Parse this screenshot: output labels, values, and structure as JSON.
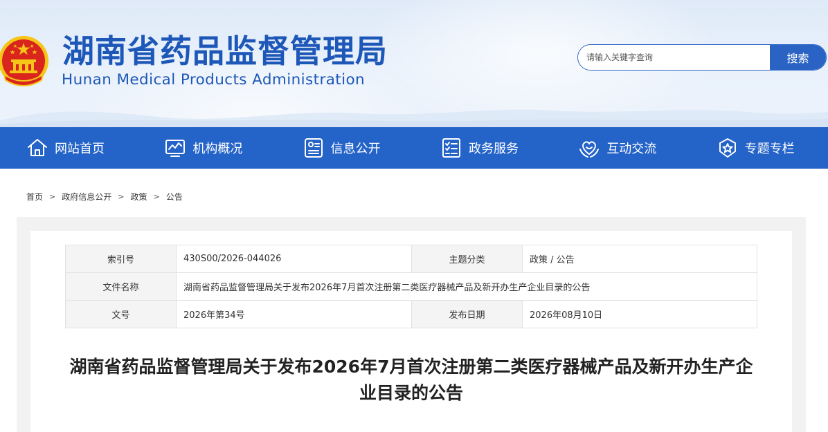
{
  "header": {
    "title": "湖南省药品监督管理局",
    "subtitle": "Hunan Medical Products Administration",
    "emblem_icon": "national-emblem-icon"
  },
  "search": {
    "placeholder": "请输入关键字查询",
    "button_label": "搜索"
  },
  "nav": {
    "items": [
      {
        "label": "网站首页",
        "icon": "home-icon"
      },
      {
        "label": "机构概况",
        "icon": "chart-monitor-icon"
      },
      {
        "label": "信息公开",
        "icon": "info-card-icon"
      },
      {
        "label": "政务服务",
        "icon": "checklist-icon"
      },
      {
        "label": "互动交流",
        "icon": "heart-hands-icon"
      },
      {
        "label": "专题专栏",
        "icon": "star-badge-icon"
      }
    ]
  },
  "breadcrumb": {
    "items": [
      "首页",
      "政府信息公开",
      "政策",
      "公告"
    ],
    "separator": ">"
  },
  "meta": {
    "index_label": "索引号",
    "index_value": "430S00/2026-044026",
    "category_label": "主题分类",
    "category_value": "政策 / 公告",
    "filename_label": "文件名称",
    "filename_value": "湖南省药品监督管理局关于发布2026年7月首次注册第二类医疗器械产品及新开办生产企业目录的公告",
    "docno_label": "文号",
    "docno_value": "2026年第34号",
    "date_label": "发布日期",
    "date_value": "2026年08月10日"
  },
  "document": {
    "title": "湖南省药品监督管理局关于发布2026年7月首次注册第二类医疗器械产品及新开办生产企业目录的公告"
  },
  "colors": {
    "brand_blue": "#1d57b8",
    "nav_blue": "#2463c8",
    "emblem_red": "#d9251d",
    "emblem_gold": "#f5c518"
  }
}
